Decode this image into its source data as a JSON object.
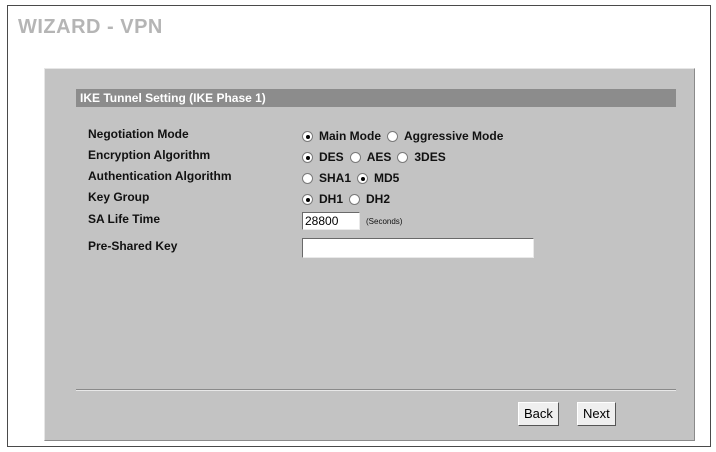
{
  "header": {
    "title": "WIZARD - VPN"
  },
  "section": {
    "title": "IKE Tunnel Setting (IKE Phase 1)"
  },
  "fields": {
    "negotiation_mode": {
      "label": "Negotiation Mode",
      "options": [
        {
          "label": "Main Mode",
          "checked": true
        },
        {
          "label": "Aggressive Mode",
          "checked": false
        }
      ]
    },
    "encryption_algorithm": {
      "label": "Encryption Algorithm",
      "options": [
        {
          "label": "DES",
          "checked": true
        },
        {
          "label": "AES",
          "checked": false
        },
        {
          "label": "3DES",
          "checked": false
        }
      ]
    },
    "authentication_algorithm": {
      "label": "Authentication Algorithm",
      "options": [
        {
          "label": "SHA1",
          "checked": false
        },
        {
          "label": "MD5",
          "checked": true
        }
      ]
    },
    "key_group": {
      "label": "Key Group",
      "options": [
        {
          "label": "DH1",
          "checked": true
        },
        {
          "label": "DH2",
          "checked": false
        }
      ]
    },
    "sa_life_time": {
      "label": "SA Life Time",
      "value": "28800",
      "unit": "(Seconds)"
    },
    "pre_shared_key": {
      "label": "Pre-Shared Key",
      "value": ""
    }
  },
  "buttons": {
    "back": "Back",
    "next": "Next"
  }
}
